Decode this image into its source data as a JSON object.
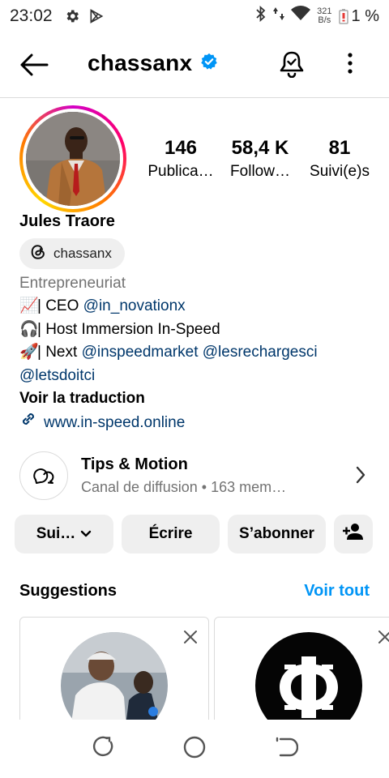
{
  "status_bar": {
    "time": "23:02",
    "net_speed_value": "321",
    "net_speed_unit": "B/s",
    "battery": "1 %"
  },
  "header": {
    "username": "chassanx",
    "verified": true
  },
  "profile": {
    "stats": [
      {
        "value": "146",
        "label": "Publica…"
      },
      {
        "value": "58,4 K",
        "label": "Follow…"
      },
      {
        "value": "81",
        "label": "Suivi(e)s"
      }
    ],
    "full_name": "Jules Traore",
    "threads_handle": "chassanx",
    "bio": {
      "category": "Entrepreneuriat",
      "line1_emoji": "📈",
      "line1_text": "| CEO ",
      "line1_link": "@in_novationx",
      "line2_emoji": "🎧",
      "line2_text": "| Host Immersion In-Speed",
      "line3_emoji": "🚀",
      "line3_text": "| Next ",
      "line3_link1": "@inspeedmarket",
      "line3_link2": "@lesrechargesci",
      "line4_link": "@letsdoitci",
      "translate": "Voir la traduction",
      "website": "www.in-speed.online"
    }
  },
  "channel": {
    "title": "Tips & Motion",
    "subtitle": "Canal de diffusion • 163 mem…"
  },
  "buttons": {
    "following": "Sui…",
    "message": "Écrire",
    "subscribe": "S’abonner"
  },
  "suggestions": {
    "title": "Suggestions",
    "see_all": "Voir tout"
  },
  "colors": {
    "link": "#00376b",
    "accent": "#0095f6",
    "verified": "#0095f6",
    "button_bg": "#efefef"
  }
}
